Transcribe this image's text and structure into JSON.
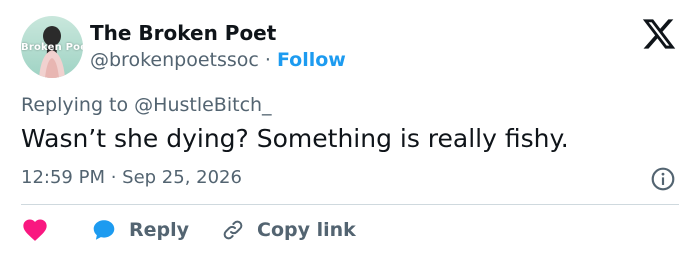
{
  "author": {
    "display_name": "The Broken Poet",
    "handle": "@brokenpoetssoc",
    "separator": " · ",
    "follow_label": "Follow",
    "avatar_text": "Broken Poet"
  },
  "tweet": {
    "replying_prefix": "Replying to ",
    "replying_to": "@HustleBitch_",
    "text": "Wasn’t she dying? Something is really fishy.",
    "timestamp": "12:59 PM · Sep 25, 2026"
  },
  "actions": {
    "reply_label": "Reply",
    "copy_link_label": "Copy link"
  },
  "icons": {
    "brand": "x-logo-icon",
    "info": "info-icon",
    "like": "heart-icon",
    "reply": "reply-bubble-icon",
    "copy": "link-icon"
  },
  "colors": {
    "accent": "#1d9bf0",
    "like": "#f91880",
    "secondary_text": "#536471",
    "primary_text": "#0f1419",
    "divider": "#cfd9de"
  }
}
